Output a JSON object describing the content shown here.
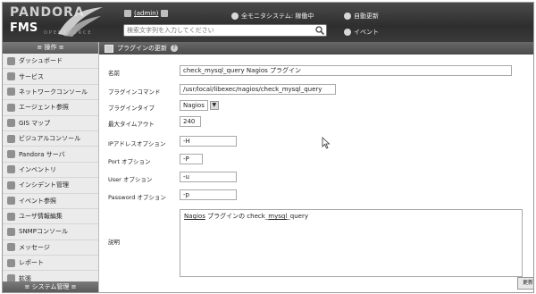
{
  "header": {
    "brand": "PANDORA",
    "product": "FMS",
    "tagline": "OPENSOURCE",
    "user_name": "(admin)",
    "status_text": "全モニタシステム: 稼働中",
    "autorefresh_label": "自動更新",
    "events_label": "イベント",
    "search_placeholder": "検索文字列を入力してください"
  },
  "sidebar": {
    "header_label": "≡ 操作 ≡",
    "footer_label": "≡ システム管理 ≡",
    "items": [
      {
        "label": "ダッシュボード",
        "icon": "dashboard-icon"
      },
      {
        "label": "サービス",
        "icon": "services-icon"
      },
      {
        "label": "ネットワークコンソール",
        "icon": "network-console-icon"
      },
      {
        "label": "エージェント参照",
        "icon": "agent-icon"
      },
      {
        "label": "GIS マップ",
        "icon": "globe-icon"
      },
      {
        "label": "ビジュアルコンソール",
        "icon": "visual-console-icon"
      },
      {
        "label": "Pandora サーバ",
        "icon": "server-icon"
      },
      {
        "label": "インベントリ",
        "icon": "inventory-icon"
      },
      {
        "label": "インシデント管理",
        "icon": "incident-icon"
      },
      {
        "label": "イベント参照",
        "icon": "events-icon"
      },
      {
        "label": "ユーザ情報編集",
        "icon": "user-icon"
      },
      {
        "label": "SNMPコンソール",
        "icon": "snmp-icon"
      },
      {
        "label": "メッセージ",
        "icon": "message-icon"
      },
      {
        "label": "レポート",
        "icon": "report-icon"
      },
      {
        "label": "拡張",
        "icon": "extensions-icon"
      }
    ]
  },
  "main": {
    "page_title": "プラグインの更新",
    "form": {
      "name_label": "名前",
      "name_value": "check_mysql_query Nagios プラグイン",
      "command_label": "プラグインコマンド",
      "command_value": "/usr/local/libexec/nagios/check_mysql_query",
      "type_label": "プラグインタイプ",
      "type_value": "Nagios",
      "timeout_label": "最大タイムアウト",
      "timeout_value": "240",
      "ip_label": "IPアドレスオプション",
      "ip_value": "-H",
      "port_label": "Port オプション",
      "port_value": "-P",
      "user_label": "User オプション",
      "user_value": "-u",
      "password_label": "Password オプション",
      "password_value": "-p",
      "description_label": "説明",
      "description_part1": "Nagios",
      "description_part2": " プラグインの check_",
      "description_part3": "mysql",
      "description_part4": "_query"
    },
    "update_button": "更新"
  }
}
